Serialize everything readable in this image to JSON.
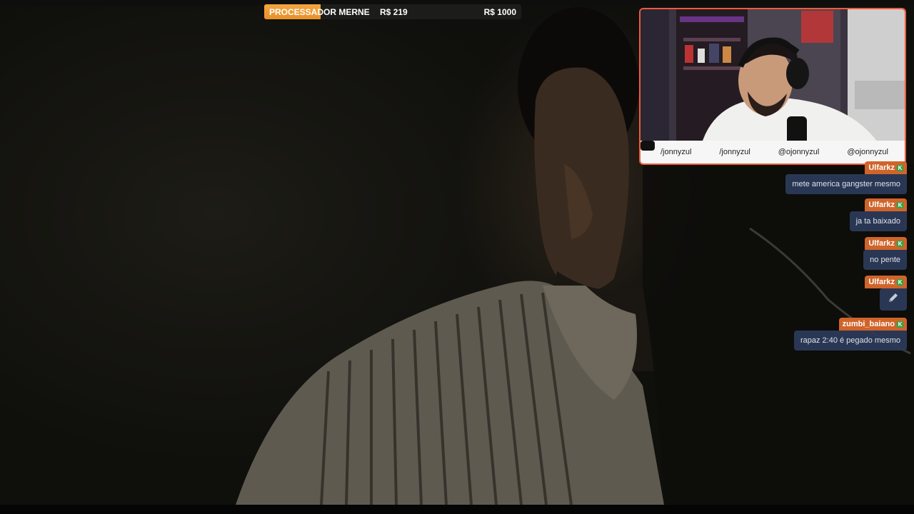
{
  "goal": {
    "label": "PROCESSADOR MERNE",
    "current": "R$ 219",
    "target": "R$ 1000",
    "progress": 0.219,
    "color": "#f4a540"
  },
  "webcam": {
    "border_color": "#f05a3c",
    "socials": [
      {
        "icon": "youtube-icon",
        "handle": "/jonnyzul"
      },
      {
        "icon": "facebook-icon",
        "handle": "/jonnyzul"
      },
      {
        "icon": "twitter-icon",
        "handle": "@ojonnyzul"
      },
      {
        "icon": "instagram-icon",
        "handle": "@ojonnyzul"
      }
    ]
  },
  "chat": {
    "username_color": "#d0642a",
    "bubble_color": "#2c3a58",
    "messages": [
      {
        "user": "Ulfarkz",
        "text": "mete america gangster mesmo"
      },
      {
        "user": "Ulfarkz",
        "text": "ja ta baixado"
      },
      {
        "user": "Ulfarkz",
        "text": "no pente"
      },
      {
        "user": "Ulfarkz",
        "text": "",
        "emote": "pencil-emote"
      },
      {
        "user": "zumbi_baiano",
        "text": "rapaz 2:40 é pegado mesmo"
      }
    ]
  }
}
